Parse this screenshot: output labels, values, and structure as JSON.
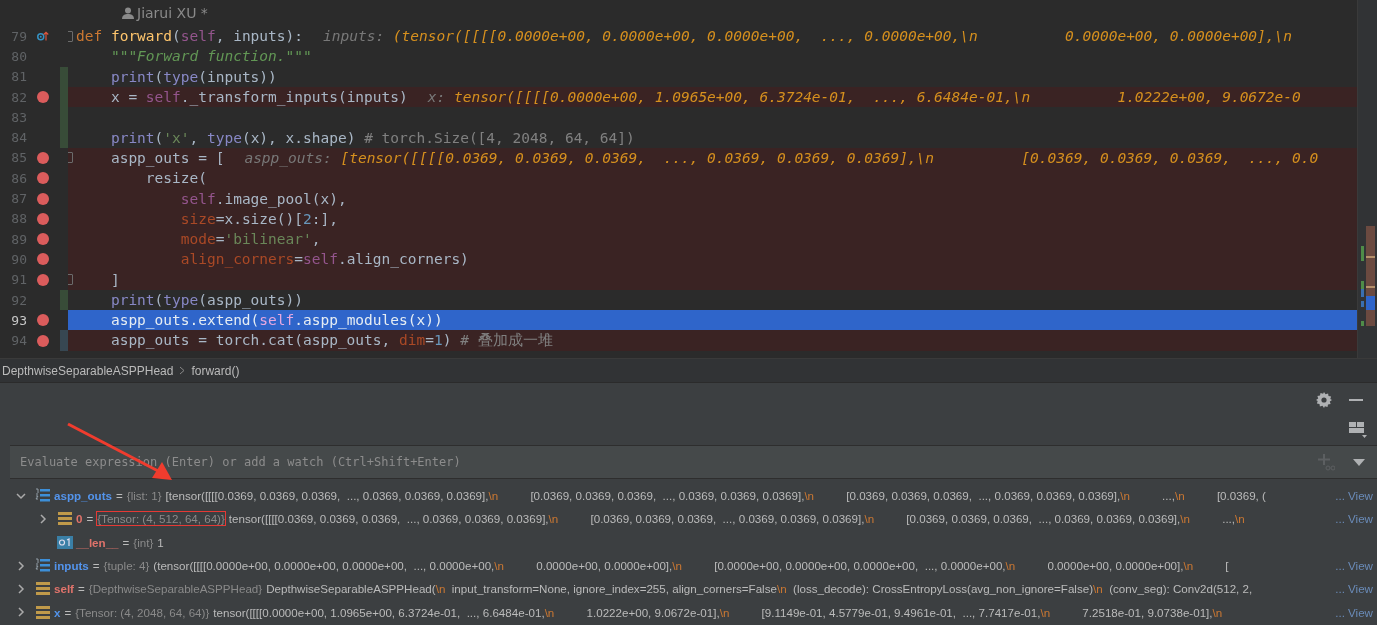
{
  "editor": {
    "author": "Jiarui XU *",
    "lines": [
      {
        "number": "79",
        "breakpoint": false,
        "override": true,
        "current": false,
        "added": false,
        "modified": false,
        "fold": true,
        "tokens": [
          {
            "kind": "kw",
            "text": "def "
          },
          {
            "kind": "fn",
            "text": "forward"
          },
          {
            "kind": "plain",
            "text": "("
          },
          {
            "kind": "self",
            "text": "self"
          },
          {
            "kind": "plain",
            "text": ", inputs):"
          }
        ],
        "hint_label": "inputs: ",
        "hint_value": "(tensor([[[[0.0000e+00, 0.0000e+00, 0.0000e+00,  ..., 0.0000e+00,\\n          0.0000e+00, 0.0000e+00],\\n"
      },
      {
        "number": "80",
        "breakpoint": false,
        "override": false,
        "current": false,
        "added": false,
        "modified": false,
        "fold": false,
        "tokens": [
          {
            "kind": "doc",
            "text": "    \"\"\"Forward function.\"\"\""
          }
        ]
      },
      {
        "number": "81",
        "breakpoint": false,
        "override": false,
        "current": false,
        "added": true,
        "modified": false,
        "fold": false,
        "tokens": [
          {
            "kind": "builtin",
            "text": "    print"
          },
          {
            "kind": "plain",
            "text": "("
          },
          {
            "kind": "builtin",
            "text": "type"
          },
          {
            "kind": "plain",
            "text": "(inputs))"
          }
        ]
      },
      {
        "number": "82",
        "breakpoint": true,
        "override": false,
        "current": false,
        "added": true,
        "modified": false,
        "fold": false,
        "tokens": [
          {
            "kind": "plain",
            "text": "    x = "
          },
          {
            "kind": "self",
            "text": "self"
          },
          {
            "kind": "plain",
            "text": "._transform_inputs(inputs)"
          }
        ],
        "hint_label": "x: ",
        "hint_value": "tensor([[[[0.0000e+00, 1.0965e+00, 6.3724e-01,  ..., 6.6484e-01,\\n          1.0222e+00, 9.0672e-0"
      },
      {
        "number": "83",
        "breakpoint": false,
        "override": false,
        "current": false,
        "added": true,
        "modified": false,
        "fold": false
      },
      {
        "number": "84",
        "breakpoint": false,
        "override": false,
        "current": false,
        "added": true,
        "modified": false,
        "fold": false,
        "tokens": [
          {
            "kind": "builtin",
            "text": "    print"
          },
          {
            "kind": "plain",
            "text": "("
          },
          {
            "kind": "string",
            "text": "'x'"
          },
          {
            "kind": "plain",
            "text": ", "
          },
          {
            "kind": "builtin",
            "text": "type"
          },
          {
            "kind": "plain",
            "text": "(x), x.shape) "
          },
          {
            "kind": "comment",
            "text": "# torch.Size([4, 2048, 64, 64])"
          }
        ]
      },
      {
        "number": "85",
        "breakpoint": true,
        "override": false,
        "current": false,
        "added": false,
        "modified": false,
        "fold": true,
        "tokens": [
          {
            "kind": "plain",
            "text": "    aspp_outs = ["
          }
        ],
        "hint_label": "aspp_outs: ",
        "hint_value": "[tensor([[[[0.0369, 0.0369, 0.0369,  ..., 0.0369, 0.0369, 0.0369],\\n          [0.0369, 0.0369, 0.0369,  ..., 0.0"
      },
      {
        "number": "86",
        "breakpoint": true,
        "override": false,
        "current": false,
        "added": false,
        "modified": false,
        "fold": false,
        "tokens": [
          {
            "kind": "plain",
            "text": "        resize("
          }
        ]
      },
      {
        "number": "87",
        "breakpoint": true,
        "override": false,
        "current": false,
        "added": false,
        "modified": false,
        "fold": false,
        "tokens": [
          {
            "kind": "self",
            "text": "            self"
          },
          {
            "kind": "plain",
            "text": ".image_pool(x),"
          }
        ]
      },
      {
        "number": "88",
        "breakpoint": true,
        "override": false,
        "current": false,
        "added": false,
        "modified": false,
        "fold": false,
        "tokens": [
          {
            "kind": "param",
            "text": "            size"
          },
          {
            "kind": "plain",
            "text": "=x.size()["
          },
          {
            "kind": "number",
            "text": "2"
          },
          {
            "kind": "plain",
            "text": ":],"
          }
        ]
      },
      {
        "number": "89",
        "breakpoint": true,
        "override": false,
        "current": false,
        "added": false,
        "modified": false,
        "fold": false,
        "tokens": [
          {
            "kind": "param",
            "text": "            mode"
          },
          {
            "kind": "plain",
            "text": "="
          },
          {
            "kind": "string",
            "text": "'bilinear'"
          },
          {
            "kind": "plain",
            "text": ","
          }
        ]
      },
      {
        "number": "90",
        "breakpoint": true,
        "override": false,
        "current": false,
        "added": false,
        "modified": false,
        "fold": false,
        "tokens": [
          {
            "kind": "param",
            "text": "            align_corners"
          },
          {
            "kind": "plain",
            "text": "="
          },
          {
            "kind": "self",
            "text": "self"
          },
          {
            "kind": "plain",
            "text": ".align_corners)"
          }
        ]
      },
      {
        "number": "91",
        "breakpoint": true,
        "override": false,
        "current": false,
        "added": false,
        "modified": false,
        "fold": true,
        "tokens": [
          {
            "kind": "plain",
            "text": "    ]"
          }
        ]
      },
      {
        "number": "92",
        "breakpoint": false,
        "override": false,
        "current": false,
        "added": true,
        "modified": false,
        "fold": false,
        "tokens": [
          {
            "kind": "builtin",
            "text": "    print"
          },
          {
            "kind": "plain",
            "text": "("
          },
          {
            "kind": "builtin",
            "text": "type"
          },
          {
            "kind": "plain",
            "text": "(aspp_outs))"
          }
        ]
      },
      {
        "number": "93",
        "breakpoint": true,
        "override": false,
        "current": true,
        "added": false,
        "modified": false,
        "fold": false,
        "tokens": [
          {
            "kind": "plain",
            "text": "    aspp_outs.extend("
          },
          {
            "kind": "self",
            "text": "self"
          },
          {
            "kind": "plain",
            "text": ".aspp_modules(x))"
          }
        ]
      },
      {
        "number": "94",
        "breakpoint": true,
        "override": false,
        "current": false,
        "added": false,
        "modified": true,
        "fold": false,
        "tokens": [
          {
            "kind": "plain",
            "text": "    aspp_outs = torch.cat(aspp_outs, "
          },
          {
            "kind": "param",
            "text": "dim"
          },
          {
            "kind": "plain",
            "text": "="
          },
          {
            "kind": "number",
            "text": "1"
          },
          {
            "kind": "plain",
            "text": ") "
          },
          {
            "kind": "comment",
            "text": "# 叠加成一堆"
          }
        ]
      }
    ]
  },
  "breadcrumbs": [
    "DepthwiseSeparableASPPHead",
    "forward()"
  ],
  "evaluate": {
    "placeholder": "Evaluate expression (Enter) or add a watch (Ctrl+Shift+Enter)"
  },
  "variables": [
    {
      "name": "aspp_outs",
      "equals": "=",
      "color": "#5394ec",
      "kind": "list",
      "expandable": true,
      "expanded": true,
      "annotated": false,
      "type": "{list: 1}",
      "value": "[tensor([[[[0.0369, 0.0369, 0.0369,  ..., 0.0369, 0.0369, 0.0369],\\n          [0.0369, 0.0369, 0.0369,  ..., 0.0369, 0.0369, 0.0369],\\n          [0.0369, 0.0369, 0.0369,  ..., 0.0369, 0.0369, 0.0369],\\n          ...,\\n          [0.0369, (",
      "link": "... View",
      "children": [
        {
          "name": "0",
          "equals": "=",
          "color": "#e0736b",
          "kind": "object",
          "expandable": true,
          "expanded": false,
          "annotated": true,
          "type": "{Tensor: (4, 512, 64, 64)}",
          "value": "tensor([[[[0.0369, 0.0369, 0.0369,  ..., 0.0369, 0.0369, 0.0369],\\n          [0.0369, 0.0369, 0.0369,  ..., 0.0369, 0.0369, 0.0369],\\n          [0.0369, 0.0369, 0.0369,  ..., 0.0369, 0.0369, 0.0369],\\n          ...,\\n",
          "link": "... View"
        },
        {
          "name": "__len__",
          "equals": "=",
          "color": "#e0736b",
          "kind": "int",
          "expandable": false,
          "expanded": false,
          "annotated": false,
          "type": "{int}",
          "value": "1"
        }
      ]
    },
    {
      "name": "inputs",
      "equals": "=",
      "color": "#5394ec",
      "kind": "list",
      "expandable": true,
      "expanded": false,
      "annotated": false,
      "type": "{tuple: 4}",
      "value": "(tensor([[[[0.0000e+00, 0.0000e+00, 0.0000e+00,  ..., 0.0000e+00,\\n          0.0000e+00, 0.0000e+00],\\n          [0.0000e+00, 0.0000e+00, 0.0000e+00,  ..., 0.0000e+00,\\n          0.0000e+00, 0.0000e+00],\\n          [",
      "link": "... View"
    },
    {
      "name": "self",
      "equals": "=",
      "color": "#e0736b",
      "kind": "object",
      "expandable": true,
      "expanded": false,
      "annotated": false,
      "type": "{DepthwiseSeparableASPPHead}",
      "value": "DepthwiseSeparableASPPHead(\\n  input_transform=None, ignore_index=255, align_corners=False\\n  (loss_decode): CrossEntropyLoss(avg_non_ignore=False)\\n  (conv_seg): Conv2d(512, 2,",
      "link": "... View"
    },
    {
      "name": "x",
      "equals": "=",
      "color": "#5394ec",
      "kind": "object",
      "expandable": true,
      "expanded": false,
      "annotated": false,
      "type": "{Tensor: (4, 2048, 64, 64)}",
      "value": "tensor([[[[0.0000e+00, 1.0965e+00, 6.3724e-01,  ..., 6.6484e-01,\\n          1.0222e+00, 9.0672e-01],\\n          [9.1149e-01, 4.5779e-01, 9.4961e-01,  ..., 7.7417e-01,\\n          7.2518e-01, 9.0738e-01],\\n",
      "link": "... View"
    }
  ]
}
